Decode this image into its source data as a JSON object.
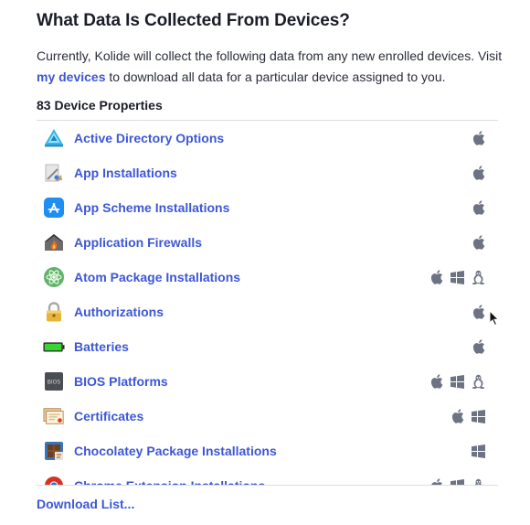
{
  "page": {
    "title": "What Data Is Collected From Devices?",
    "intro_before": "Currently, Kolide will collect the following data from any new enrolled devices. Visit ",
    "intro_link": "my devices",
    "intro_after": " to download all data for a particular device assigned to you.",
    "count_label": "83 Device Properties",
    "download_label": "Download List..."
  },
  "properties": [
    {
      "label": "Active Directory Options",
      "icon": "active-directory-icon",
      "os": [
        "apple"
      ]
    },
    {
      "label": "App Installations",
      "icon": "app-installer-icon",
      "os": [
        "apple"
      ]
    },
    {
      "label": "App Scheme Installations",
      "icon": "app-store-icon",
      "os": [
        "apple"
      ]
    },
    {
      "label": "Application Firewalls",
      "icon": "firewall-icon",
      "os": [
        "apple"
      ]
    },
    {
      "label": "Atom Package Installations",
      "icon": "atom-icon",
      "os": [
        "apple",
        "windows",
        "linux"
      ]
    },
    {
      "label": "Authorizations",
      "icon": "lock-icon",
      "os": [
        "apple"
      ]
    },
    {
      "label": "Batteries",
      "icon": "battery-icon",
      "os": [
        "apple"
      ]
    },
    {
      "label": "BIOS Platforms",
      "icon": "bios-chip-icon",
      "os": [
        "apple",
        "windows",
        "linux"
      ]
    },
    {
      "label": "Certificates",
      "icon": "certificate-icon",
      "os": [
        "apple",
        "windows"
      ]
    },
    {
      "label": "Chocolatey Package Installations",
      "icon": "chocolatey-icon",
      "os": [
        "windows"
      ]
    },
    {
      "label": "Chrome Extension Installations",
      "icon": "chrome-icon",
      "os": [
        "apple",
        "windows",
        "linux"
      ]
    }
  ],
  "colors": {
    "link": "#3d57d6",
    "os_icon": "#6d7383"
  }
}
